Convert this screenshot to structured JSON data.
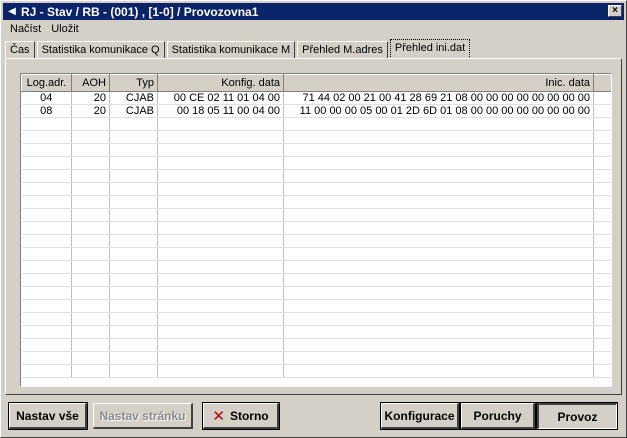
{
  "window": {
    "title": "RJ - Stav / RB - (001) , [1-0] / Provozovna1",
    "close": "×"
  },
  "menu": {
    "load": "Načíst",
    "save": "Uložit"
  },
  "tabs": [
    {
      "label": "Čas"
    },
    {
      "label": "Statistika komunikace Q"
    },
    {
      "label": "Statistika komunikace M"
    },
    {
      "label": "Přehled M.adres"
    },
    {
      "label": "Přehled ini.dat"
    }
  ],
  "table": {
    "columns": [
      "Log.adr.",
      "AOH",
      "Typ",
      "Konfig. data",
      "Inic. data"
    ],
    "rows": [
      [
        "04",
        "20",
        "CJAB",
        "00 CE 02 11 01 04 00",
        "71 44 02 00 21 00 41 28 69 21 08 00 00 00 00 00 00 00 00"
      ],
      [
        "08",
        "20",
        "CJAB",
        "00 18 05 11 00 04 00",
        "11 00 00 00 05 00 01 2D 6D 01 08 00 00 00 00 00 00 00 00"
      ]
    ]
  },
  "buttons": {
    "set_all": "Nastav vše",
    "set_page": "Nastav stránku",
    "cancel": "Storno",
    "config": "Konfigurace",
    "faults": "Poruchy",
    "operation": "Provoz"
  }
}
